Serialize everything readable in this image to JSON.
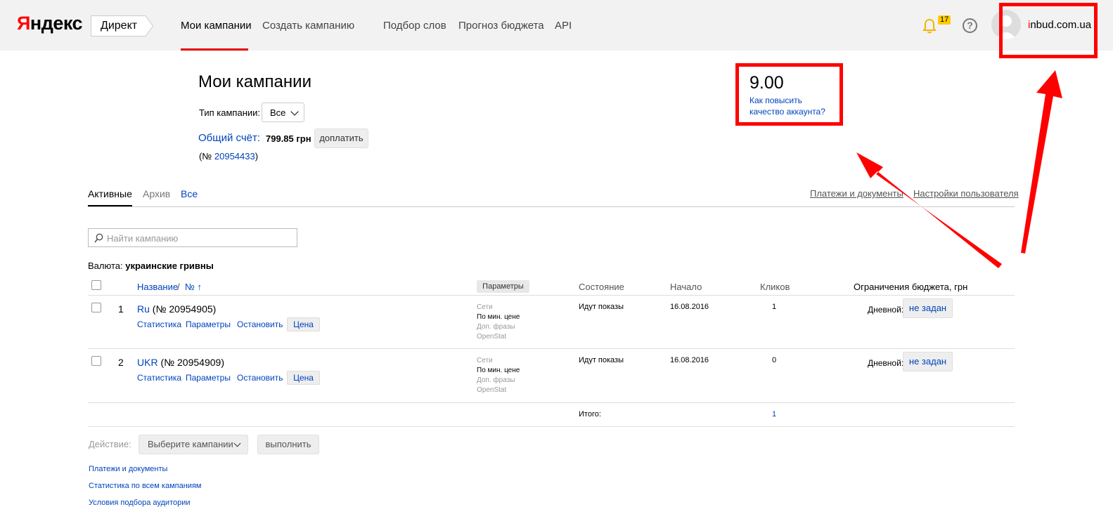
{
  "header": {
    "logo": "Яндекс",
    "service": "Директ",
    "nav": [
      "Мои кампании",
      "Создать кампанию",
      "Подбор слов",
      "Прогноз бюджета",
      "API"
    ],
    "notif_count": "17",
    "help": "?",
    "user": "inbud.com.ua",
    "accent_color": "#e60000"
  },
  "page": {
    "title": "Мои кампании",
    "camp_type_label": "Тип кампании:",
    "camp_type_value": "Все",
    "account_label": "Общий счёт:",
    "account_amount": "799.85 грн",
    "topup": "доплатить",
    "account_no_prefix": "(№ ",
    "account_no": "20954433",
    "account_no_suffix": ")"
  },
  "quality": {
    "score": "9.00",
    "link_line1": "Как повысить",
    "link_line2": "качество аккаунта?"
  },
  "tabs": [
    "Активные",
    "Архив",
    "Все"
  ],
  "links": {
    "payments": "Платежи и документы",
    "settings": "Настройки пользователя"
  },
  "search": {
    "placeholder": "Найти кампанию"
  },
  "currency": {
    "label": "Валюта:",
    "value": "украинские гривны"
  },
  "table": {
    "headers": {
      "name": "Название",
      "sep": " / ",
      "num": "№ ↑",
      "params": "Параметры",
      "state": "Состояние",
      "start": "Начало",
      "clicks": "Кликов",
      "budget": "Ограничения бюджета, грн"
    },
    "rows": [
      {
        "n": "1",
        "name": "Ru",
        "no": "(№ 20954905)",
        "actions": [
          "Статистика",
          "Параметры",
          "Остановить"
        ],
        "price": "Цена",
        "strategy": [
          "Сети",
          "По мин. цене",
          "Доп. фразы",
          "OpenStat"
        ],
        "state": "Идут показы",
        "start": "16.08.2016",
        "clicks": "1",
        "daily_label": "Дневной:",
        "daily_value": "не задан"
      },
      {
        "n": "2",
        "name": "UKR",
        "no": "(№ 20954909)",
        "actions": [
          "Статистика",
          "Параметры",
          "Остановить"
        ],
        "price": "Цена",
        "strategy": [
          "Сети",
          "По мин. цене",
          "Доп. фразы",
          "OpenStat"
        ],
        "state": "Идут показы",
        "start": "16.08.2016",
        "clicks": "0",
        "daily_label": "Дневной:",
        "daily_value": "не задан"
      }
    ],
    "total_label": "Итого:",
    "total_clicks": "1"
  },
  "actions": {
    "label": "Действие:",
    "select": "Выберите кампании",
    "run": "выполнить"
  },
  "footer_links": [
    "Платежи и документы",
    "Статистика по всем кампаниям",
    "Условия подбора аудитории"
  ],
  "annotation_color": "#ff0000"
}
